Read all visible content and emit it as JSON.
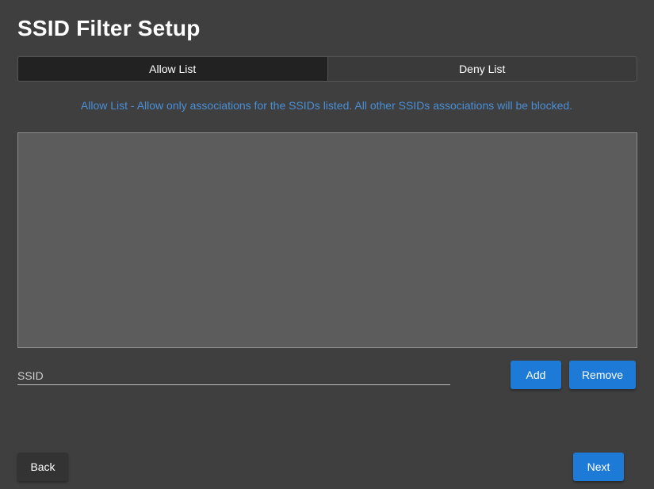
{
  "page": {
    "title": "SSID Filter Setup"
  },
  "tabs": [
    {
      "label": "Allow List",
      "active": true
    },
    {
      "label": "Deny List",
      "active": false
    }
  ],
  "description": "Allow List - Allow only associations for the SSIDs listed. All other SSIDs associations will be blocked.",
  "ssid_list": {
    "items": []
  },
  "ssid_input": {
    "placeholder": "SSID",
    "value": ""
  },
  "actions": {
    "add_label": "Add",
    "remove_label": "Remove"
  },
  "footer": {
    "back_label": "Back",
    "next_label": "Next"
  },
  "colors": {
    "background": "#3f3f3f",
    "accent": "#1d7ad6",
    "description_text": "#4a8fd6",
    "active_tab": "#222222",
    "list_background": "#5c5c5c"
  }
}
